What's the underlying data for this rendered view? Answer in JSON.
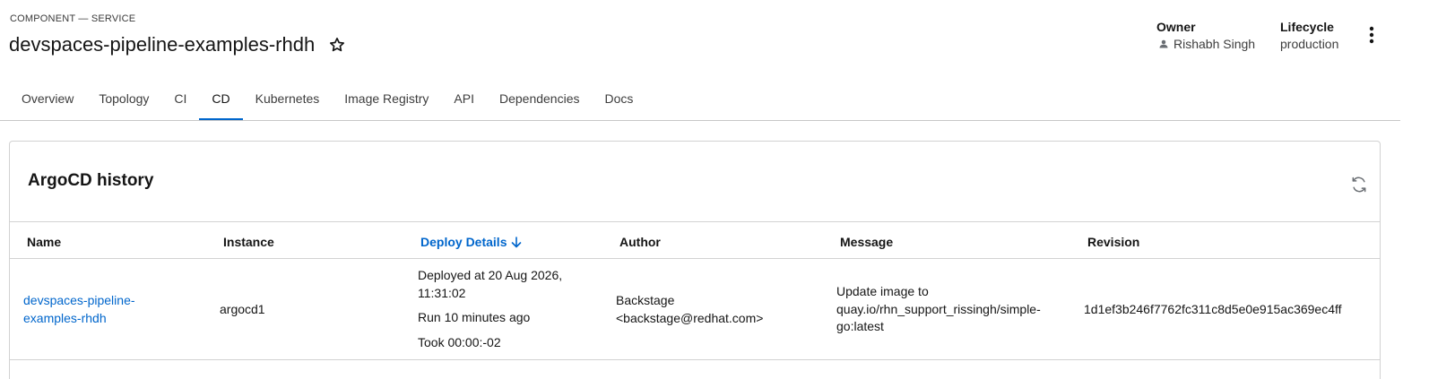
{
  "header": {
    "kind": "COMPONENT — SERVICE",
    "title": "devspaces-pipeline-examples-rhdh",
    "owner_label": "Owner",
    "owner_value": "Rishabh Singh",
    "lifecycle_label": "Lifecycle",
    "lifecycle_value": "production"
  },
  "tabs": [
    {
      "label": "Overview"
    },
    {
      "label": "Topology"
    },
    {
      "label": "CI"
    },
    {
      "label": "CD"
    },
    {
      "label": "Kubernetes"
    },
    {
      "label": "Image Registry"
    },
    {
      "label": "API"
    },
    {
      "label": "Dependencies"
    },
    {
      "label": "Docs"
    }
  ],
  "active_tab": "CD",
  "card": {
    "title": "ArgoCD history",
    "columns": {
      "name": "Name",
      "instance": "Instance",
      "deploy_details": "Deploy Details",
      "author": "Author",
      "message": "Message",
      "revision": "Revision"
    },
    "rows": [
      {
        "name_line1": "devspaces-pipeline-",
        "name_line2": "examples-rhdh",
        "instance": "argocd1",
        "deployed_line1": "Deployed at 20 Aug 2026,",
        "deployed_line2": "11:31:02",
        "run": "Run 10 minutes ago",
        "took": "Took 00:00:-02",
        "author_line1": "Backstage",
        "author_line2": "<backstage@redhat.com>",
        "message_line1": "Update image to",
        "message_line2": "quay.io/rhn_support_rissingh/simple-",
        "message_line3": "go:latest",
        "revision": "1d1ef3b246f7762fc311c8d5e0e915ac369ec4ff"
      }
    ]
  },
  "colors": {
    "accent": "#0066cc",
    "border": "#d2d2d2",
    "text": "#151515"
  },
  "icons": {
    "favorite": "star-outline-icon",
    "owner": "person-icon",
    "menu": "kebab-menu-icon",
    "refresh": "refresh-icon",
    "sort": "arrow-down-icon"
  }
}
